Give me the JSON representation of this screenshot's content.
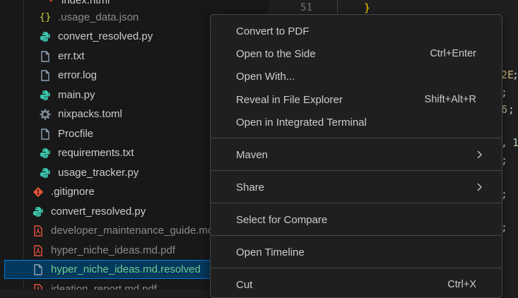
{
  "explorer": {
    "items": [
      {
        "label": "index.html",
        "icon": "html-icon",
        "color": "#e44d26",
        "status": "normal"
      },
      {
        "label": ".usage_data.json",
        "icon": "json-icon",
        "color": "#cbcb41",
        "status": "dim"
      },
      {
        "label": "convert_resolved.py",
        "icon": "python-icon",
        "color": "#3dc9b0",
        "status": "normal"
      },
      {
        "label": "err.txt",
        "icon": "file-icon",
        "color": "#8fa3b8",
        "status": "normal"
      },
      {
        "label": "error.log",
        "icon": "file-icon",
        "color": "#8fa3b8",
        "status": "normal"
      },
      {
        "label": "main.py",
        "icon": "python-icon",
        "color": "#3dc9b0",
        "status": "normal"
      },
      {
        "label": "nixpacks.toml",
        "icon": "gear-icon",
        "color": "#7f8b98",
        "status": "normal"
      },
      {
        "label": "Procfile",
        "icon": "file-icon",
        "color": "#8fa3b8",
        "status": "normal"
      },
      {
        "label": "requirements.txt",
        "icon": "python-icon",
        "color": "#3dc9b0",
        "status": "normal"
      },
      {
        "label": "usage_tracker.py",
        "icon": "python-icon",
        "color": "#3dc9b0",
        "status": "normal"
      },
      {
        "label": ".gitignore",
        "icon": "git-icon",
        "color": "#e8533a",
        "status": "normal"
      },
      {
        "label": "convert_resolved.py",
        "icon": "python-icon",
        "color": "#3dc9b0",
        "status": "normal"
      },
      {
        "label": "developer_maintenance_guide.md.pdf",
        "icon": "pdf-icon",
        "color": "#e5533d",
        "status": "pdf"
      },
      {
        "label": "hyper_niche_ideas.md.pdf",
        "icon": "pdf-icon",
        "color": "#e5533d",
        "status": "pdf"
      },
      {
        "label": "hyper_niche_ideas.md.resolved",
        "icon": "file-icon",
        "color": "#8fa3b8",
        "status": "selected"
      },
      {
        "label": "ideation_report.md.pdf",
        "icon": "pdf-icon",
        "color": "#e5533d",
        "status": "pdf"
      }
    ]
  },
  "editor": {
    "line_number": "51",
    "brace": "}",
    "fragments": [
      {
        "text": "2E",
        "color": "#d7ba7d"
      },
      {
        "text": ";",
        "color": "#cccccc"
      },
      {
        "text": ";",
        "color": "#cccccc"
      },
      {
        "text": "6",
        "color": "#b5cea8"
      },
      {
        "text": ";",
        "color": "#cccccc"
      },
      {
        "text": ",",
        "color": "#cccccc"
      },
      {
        "text": "1",
        "color": "#b5cea8"
      },
      {
        "text": ";",
        "color": "#cccccc"
      },
      {
        "text": ";",
        "color": "#cccccc"
      },
      {
        "text": ";",
        "color": "#cccccc"
      }
    ]
  },
  "context_menu": {
    "items": [
      {
        "label": "Convert to PDF",
        "shortcut": ""
      },
      {
        "label": "Open to the Side",
        "shortcut": "Ctrl+Enter"
      },
      {
        "label": "Open With...",
        "shortcut": ""
      },
      {
        "label": "Reveal in File Explorer",
        "shortcut": "Shift+Alt+R"
      },
      {
        "label": "Open in Integrated Terminal",
        "shortcut": ""
      },
      {
        "label": "Maven",
        "shortcut": "",
        "submenu": true
      },
      {
        "label": "Share",
        "shortcut": "",
        "submenu": true
      },
      {
        "label": "Select for Compare",
        "shortcut": ""
      },
      {
        "label": "Open Timeline",
        "shortcut": ""
      },
      {
        "label": "Cut",
        "shortcut": "Ctrl+X"
      }
    ]
  }
}
